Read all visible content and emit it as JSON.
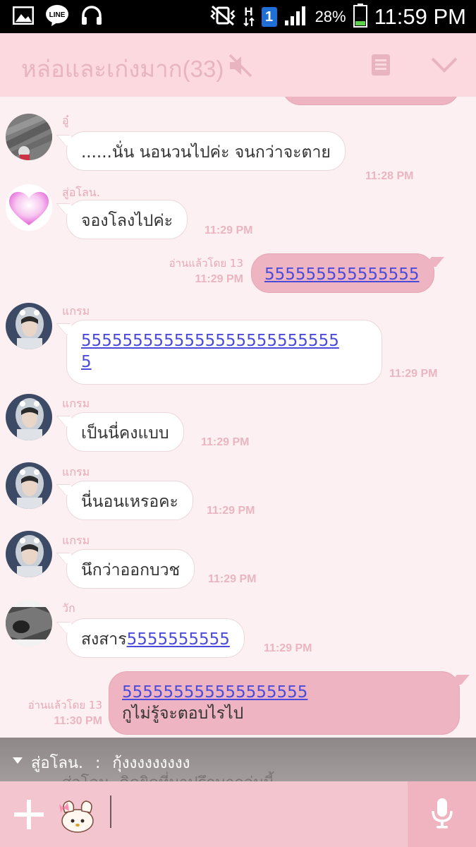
{
  "status_bar": {
    "icons": [
      "picture-icon",
      "line-app-icon",
      "headset-icon",
      "mute-vibrate-icon",
      "hspa-data-icon",
      "sim-1-icon",
      "signal-icon",
      "battery-icon"
    ],
    "line_badge": "LINE",
    "network": "H",
    "sim": "1",
    "battery": "28%",
    "time": "11:59 PM"
  },
  "header": {
    "title": "หล่อและเก่งมาก(33)",
    "icons": [
      "mute-icon",
      "notes-icon",
      "chevron-down-icon"
    ]
  },
  "messages": [
    {
      "sender": "อู๋",
      "text": "......นั่น นอนวนไปค่ะ จนกว่าจะตาย",
      "time": "11:28 PM"
    },
    {
      "sender": "สู่อโลน.",
      "text": "จองโลงไปค่ะ",
      "time": "11:29 PM"
    },
    {
      "direction": "out",
      "text": "555555555555555",
      "read": "อ่านแล้วโดย 13",
      "time": "11:29 PM"
    },
    {
      "sender": "แกรม",
      "line1": "5555555555555555555555555",
      "line2": "5",
      "time": "11:29 PM"
    },
    {
      "sender": "แกรม",
      "text": "เป็นนี่คงแบบ",
      "time": "11:29 PM"
    },
    {
      "sender": "แกรม",
      "text": "นี่นอนเหรอคะ",
      "time": "11:29 PM"
    },
    {
      "sender": "แกรม",
      "text": "นึกว่าออกบวช",
      "time": "11:29 PM"
    },
    {
      "sender": "วัก",
      "prefix": "สงสาร",
      "link": "5555555555",
      "time": "11:29 PM"
    },
    {
      "direction": "out",
      "line1": "555555555555555555",
      "line2": "กูไม่รู้จะตอบไรไป",
      "read": "อ่านแล้วโดย 13",
      "time": "11:30 PM"
    }
  ],
  "notification": {
    "sender": "สู่อโลน.",
    "separator": ":",
    "text": "กุ้งงงงงงงงง",
    "underlay_sender": "สู่อโลน.",
    "underlay_text": "คิดยิดที่มาปรึกษากลุ่มนี้"
  },
  "input_bar": {
    "placeholder": "",
    "icons": [
      "plus-icon",
      "sticker-icon",
      "microphone-icon"
    ]
  },
  "colors": {
    "header_bg": "#fbd9df",
    "chat_bg": "#fdf0f2",
    "outgoing_bubble": "#eeb4c1",
    "timestamp": "#eab5c1",
    "link": "#4a4adb"
  }
}
